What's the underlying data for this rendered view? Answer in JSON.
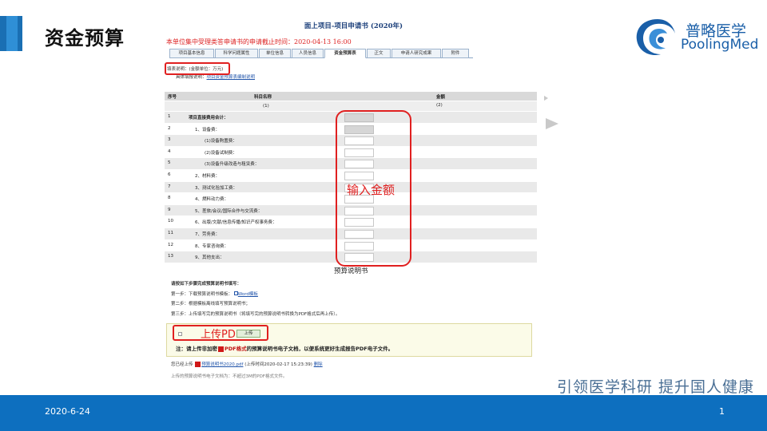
{
  "slide": {
    "title": "资金预算",
    "logo_cn": "普略医学",
    "logo_en": "PoolingMed",
    "slogan": "引领医学科研  提升国人健康",
    "date": "2020-6-24",
    "page": "1",
    "colors": {
      "accent": "#0d6fbf",
      "highlight": "#e02020"
    }
  },
  "form": {
    "title": "面上项目-项目申请书 (2020年)",
    "deadline": "本单位集中受理类答申请书的申请截止时间：2020-04-13 16:00",
    "tabs": [
      "项目基本信息",
      "科学问题属性",
      "单位信息",
      "人员信息",
      "资金预算表",
      "正文",
      "申请人研究成果",
      "附件"
    ],
    "active_tab": "资金预算表",
    "note_unit": "填表说明：(金额单位：万元)",
    "note_link_prefix": "具体填报说明：",
    "note_link": "项目资金预算表编制说明",
    "table": {
      "headers": {
        "no": "序号",
        "name": "科目名称",
        "amount": "金额"
      },
      "subheaders": {
        "name": "(1)",
        "amount": "(2)"
      },
      "rows": [
        {
          "no": "1",
          "name": "项目直接费用合计：",
          "indent": 0,
          "readonly": true,
          "bold": true
        },
        {
          "no": "2",
          "name": "1、设备费：",
          "indent": 1,
          "readonly": true
        },
        {
          "no": "3",
          "name": "(1)设备购置费：",
          "indent": 2,
          "readonly": false
        },
        {
          "no": "4",
          "name": "(2)设备试制费：",
          "indent": 2,
          "readonly": false
        },
        {
          "no": "5",
          "name": "(3)设备升级改造与租赁费：",
          "indent": 2,
          "readonly": false
        },
        {
          "no": "6",
          "name": "2、材料费：",
          "indent": 1,
          "readonly": false
        },
        {
          "no": "7",
          "name": "3、测试化验加工费：",
          "indent": 1,
          "readonly": false
        },
        {
          "no": "8",
          "name": "4、燃料动力费：",
          "indent": 1,
          "readonly": false
        },
        {
          "no": "9",
          "name": "5、差旅/会议/国际合作与交流费：",
          "indent": 1,
          "readonly": false
        },
        {
          "no": "10",
          "name": "6、出版/文献/信息传播/知识产权事务费：",
          "indent": 1,
          "readonly": false
        },
        {
          "no": "11",
          "name": "7、劳务费：",
          "indent": 1,
          "readonly": false
        },
        {
          "no": "12",
          "name": "8、专家咨询费：",
          "indent": 1,
          "readonly": false
        },
        {
          "no": "13",
          "name": "9、其他支出：",
          "indent": 1,
          "readonly": false
        }
      ]
    },
    "annotation_amount": "输入金额",
    "budget_title": "预算说明书",
    "steps": {
      "intro": "请按如下步骤完成预算说明书填写：",
      "step1": "第一步：下载预算说明书模板：",
      "step1_link": "Word模板",
      "step2": "第二步：根据模板离线填写预算说明书；",
      "step3": "第三步：上传填写完的预算说明书（将填写完的预算说明书转换为PDF格式后再上传）。"
    },
    "annotation_upload": "上传PDF",
    "upload_button": "上传",
    "upload_note_prefix": "注：请上传非加密",
    "upload_note_red": "PDF格式",
    "upload_note_suffix": "的预算说明书电子文档，以便系统更好生成报告PDF电子文件。",
    "uploaded_prefix": "您已经上传",
    "uploaded_file": "预算说明书2020.pdf",
    "uploaded_time": "(上传时间2020-02-17 15:23:39)",
    "delete_link": "删除",
    "size_note": "上传的预算说明书电子文档为：不超过3M的PDF格式文件。"
  }
}
